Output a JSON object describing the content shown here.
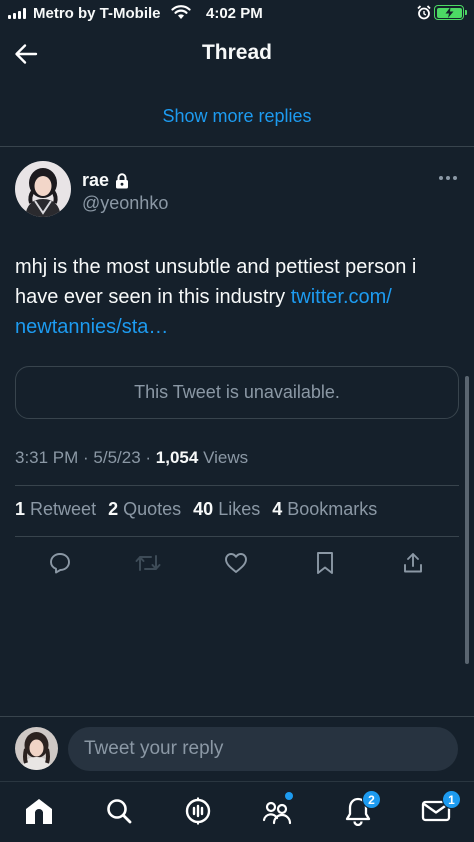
{
  "status_bar": {
    "carrier": "Metro by T-Mobile",
    "time": "4:02 PM"
  },
  "header": {
    "title": "Thread"
  },
  "thread": {
    "show_more_replies": "Show more replies"
  },
  "tweet": {
    "author_name": "rae",
    "author_handle": "@yeonhko",
    "text": "mhj is the most unsubtle and pettiest person i have ever seen in this industry ",
    "link_text": "twitter.com/ newtannies/sta…",
    "quoted_unavailable": "This Tweet is unavailable.",
    "time": "3:31 PM",
    "date": "5/5/23",
    "views_count": "1,054",
    "views_label": "Views",
    "stats": {
      "retweets_count": "1",
      "retweets_label": "Retweet",
      "quotes_count": "2",
      "quotes_label": "Quotes",
      "likes_count": "40",
      "likes_label": "Likes",
      "bookmarks_count": "4",
      "bookmarks_label": "Bookmarks"
    }
  },
  "reply": {
    "placeholder": "Tweet your reply"
  },
  "tab_bar": {
    "notifications_badge": "2",
    "messages_badge": "1"
  },
  "colors": {
    "background": "#15202b",
    "accent": "#1d9bf0",
    "secondary_text": "#8b98a5",
    "border": "#38444d",
    "battery": "#4cd964"
  }
}
